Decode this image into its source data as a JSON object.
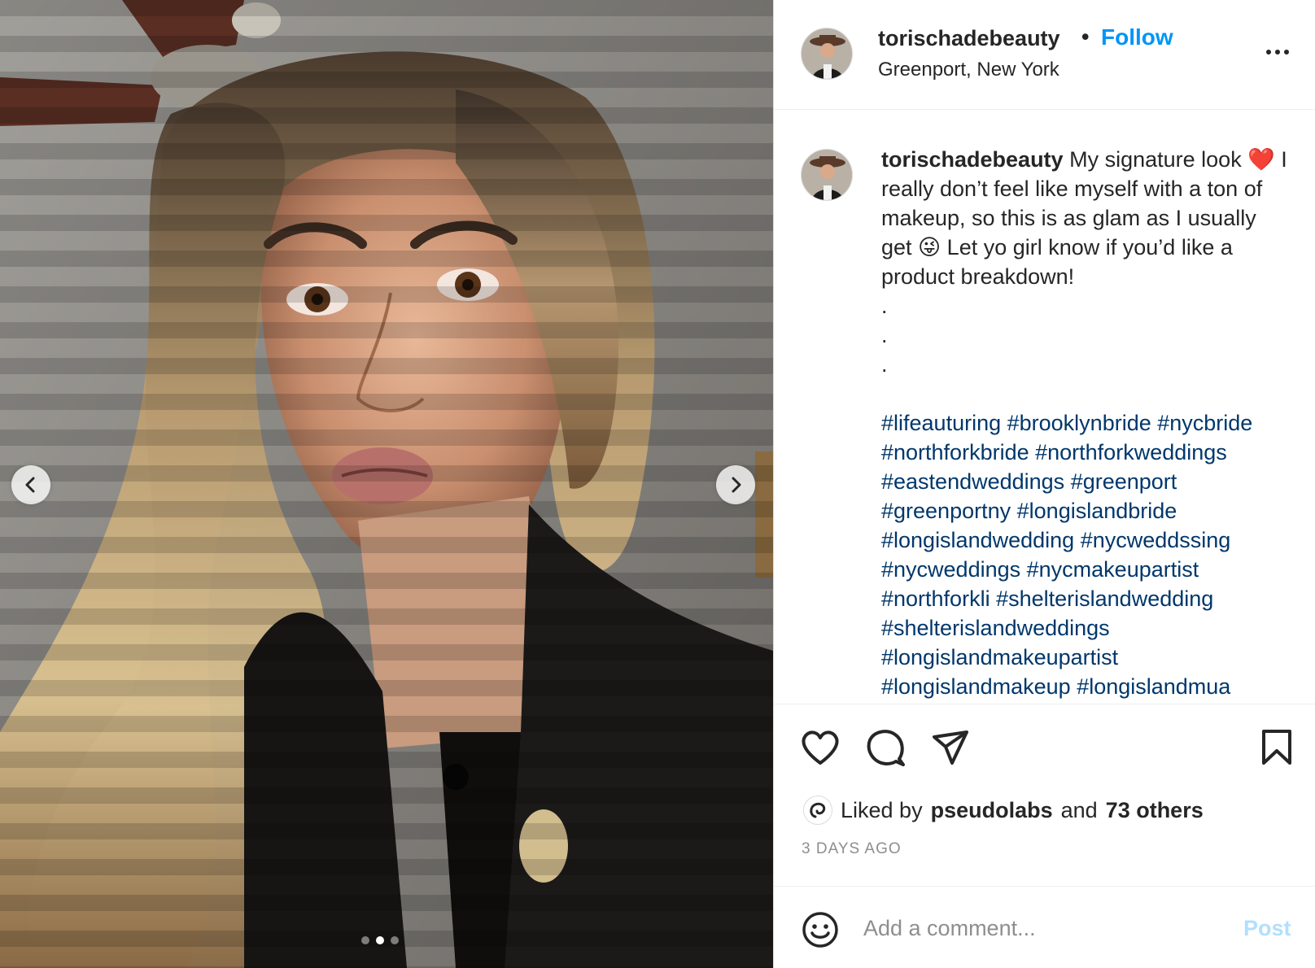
{
  "post": {
    "username": "torischadebeauty",
    "separator": "•",
    "follow_label": "Follow",
    "location": "Greenport, New York",
    "more_icon": "more-horizontal-icon",
    "caption_text": "My signature look ❤️ I really don’t feel like myself with a ton of makeup, so this is as glam as I usually get 😜 Let yo girl know if you’d like a product breakdown!",
    "caption_dots": [
      ".",
      ".",
      "."
    ],
    "hashtags": [
      "#lifeauturing",
      "#brooklynbride",
      "#nycbride",
      "#northforkbride",
      "#northforkweddings",
      "#eastendweddings",
      "#greenport",
      "#greenportny",
      "#longislandbride",
      "#longislandwedding",
      "#nycweddssing",
      "#nycweddings",
      "#nycmakeupartist",
      "#northforkli",
      "#shelterislandwedding",
      "#shelterislandweddings",
      "#longislandmakeupartist",
      "#longislandmakeup",
      "#longislandmua"
    ],
    "likes": {
      "prefix": "Liked by",
      "user": "pseudolabs",
      "connector": "and",
      "others": "73 others"
    },
    "time_ago": "3 DAYS AGO",
    "comment": {
      "placeholder": "Add a comment...",
      "value": "",
      "post_label": "Post"
    },
    "carousel": {
      "slide_count": 3,
      "active_index": 1
    }
  },
  "colors": {
    "link_blue": "#0095f6",
    "hashtag": "#00376b",
    "text": "#262626",
    "muted": "#8e8e8e",
    "post_disabled": "#b2dffc"
  },
  "icons": [
    "chevron-left-icon",
    "chevron-right-icon",
    "heart-icon",
    "comment-icon",
    "paper-plane-icon",
    "bookmark-icon",
    "emoji-icon",
    "more-horizontal-icon"
  ]
}
